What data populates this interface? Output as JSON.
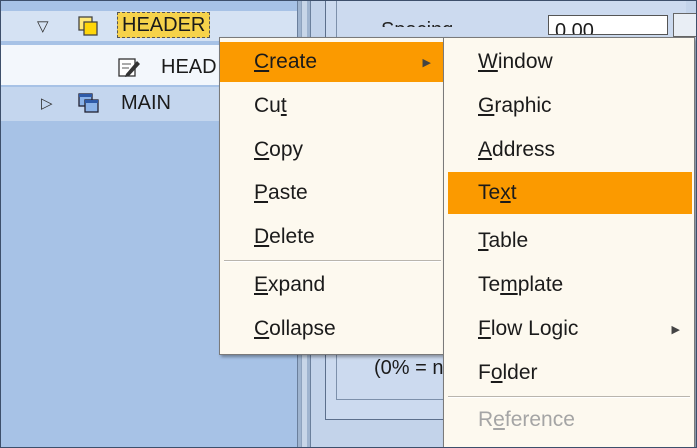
{
  "tree": {
    "items": [
      {
        "label": "HEADER",
        "toggle": "▽",
        "icon": "folder-icon"
      },
      {
        "label": "HEAD",
        "icon": "text-edit-icon"
      },
      {
        "label": "MAIN",
        "toggle": "▷",
        "icon": "window-icon"
      }
    ]
  },
  "form": {
    "spacing_label": "Spacing",
    "spacing_value": "0.00",
    "percent_note": "(0% = n"
  },
  "context_menu": {
    "items": [
      {
        "label": "Create",
        "accel": "C",
        "rest": "reate",
        "has_submenu": true,
        "active": true
      },
      {
        "label": "Cut",
        "accel": "t",
        "pre": "Cu"
      },
      {
        "label": "Copy",
        "accel": "C",
        "rest": "opy"
      },
      {
        "label": "Paste",
        "accel": "P",
        "rest": "aste"
      },
      {
        "label": "Delete",
        "accel": "D",
        "rest": "elete"
      },
      {
        "label": "Expand",
        "accel": "E",
        "rest": "xpand"
      },
      {
        "label": "Collapse",
        "accel": "C",
        "rest": "ollapse"
      }
    ]
  },
  "submenu": {
    "items": [
      {
        "label": "Window",
        "accel": "W",
        "rest": "indow"
      },
      {
        "label": "Graphic",
        "accel": "G",
        "rest": "raphic"
      },
      {
        "label": "Address",
        "accel": "A",
        "rest": "ddress"
      },
      {
        "label": "Text",
        "pre": "Te",
        "accel": "x",
        "post": "t",
        "active": true
      },
      {
        "label": "Table",
        "accel": "T",
        "rest": "able"
      },
      {
        "label": "Template",
        "pre": "Te",
        "accel": "m",
        "post": "plate"
      },
      {
        "label": "Flow Logic",
        "accel": "F",
        "rest": "low Logic",
        "has_submenu": true
      },
      {
        "label": "Folder",
        "pre": "F",
        "accel": "o",
        "post": "lder"
      },
      {
        "label": "Reference",
        "pre": "R",
        "accel": "e",
        "post": "ference",
        "disabled": true
      }
    ]
  },
  "colors": {
    "highlight": "#fb9a00",
    "tree_bg": "#a7c2e6",
    "header_node": "#f6d24a"
  }
}
